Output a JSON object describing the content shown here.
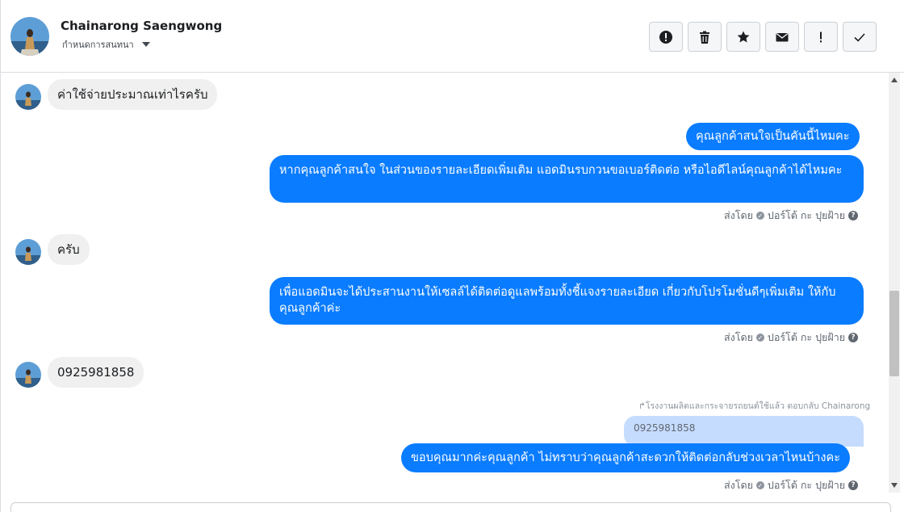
{
  "header": {
    "contact_name": "Chainarong Saengwong",
    "subtitle": "กำหนดการสนทนา"
  },
  "toolbar": {
    "buttons": [
      {
        "name": "report-spam",
        "icon": "alert-circle-icon"
      },
      {
        "name": "delete",
        "icon": "trash-icon"
      },
      {
        "name": "star",
        "icon": "star-icon"
      },
      {
        "name": "mark-unread",
        "icon": "envelope-icon"
      },
      {
        "name": "mark-important",
        "icon": "exclamation-icon"
      },
      {
        "name": "mark-done",
        "icon": "checkmark-icon"
      }
    ]
  },
  "messages": {
    "m1": "ค่าใช้จ่ายประมาณเท่าไรครับ",
    "m2": "คุณลูกค้าสนใจเป็นคันนี้ไหมคะ",
    "m3": "หากคุณลูกค้าสนใจ ในส่วนของรายละเอียดเพิ่มเติม แอดมินรบกวนขอเบอร์ติดต่อ หรือไอดีไลน์คุณลูกค้าได้ไหมคะ",
    "m3_meta": "ส่งโดย",
    "m3_sender": "ปอร์โต้ กะ ปุยฝ้าย",
    "m4": "ครับ",
    "m5": "เพื่อแอดมินจะได้ประสานงานให้เซลล์ได้ติดต่อดูแลพร้อมทั้งชี้แจงรายละเอียด เกี่ยวกับโปรโมชั่นดีๆเพิ่มเติม ให้กับคุณลูกค้าค่ะ",
    "m5_meta": "ส่งโดย",
    "m5_sender": "ปอร์โต้ กะ ปุยฝ้าย",
    "m6": "0925981858",
    "reply_note": "โรงงานผลิตและกระจายรถยนต์ใช้แล้ว ตอบกลับ Chainarong",
    "quoted": "0925981858",
    "m7": "ขอบคุณมากค่ะคุณลูกค้า ไม่ทราบว่าคุณลูกค้าสะดวกให้ติดต่อกลับช่วงเวลาไหนบ้างคะ",
    "m7_meta": "ส่งโดย",
    "m7_sender": "ปอร์โต้ กะ ปุยฝ้าย"
  },
  "colors": {
    "outgoing_bubble": "#0a7cff",
    "incoming_bubble": "#f0f0f0",
    "quoted_bubble": "#c6dcff"
  }
}
